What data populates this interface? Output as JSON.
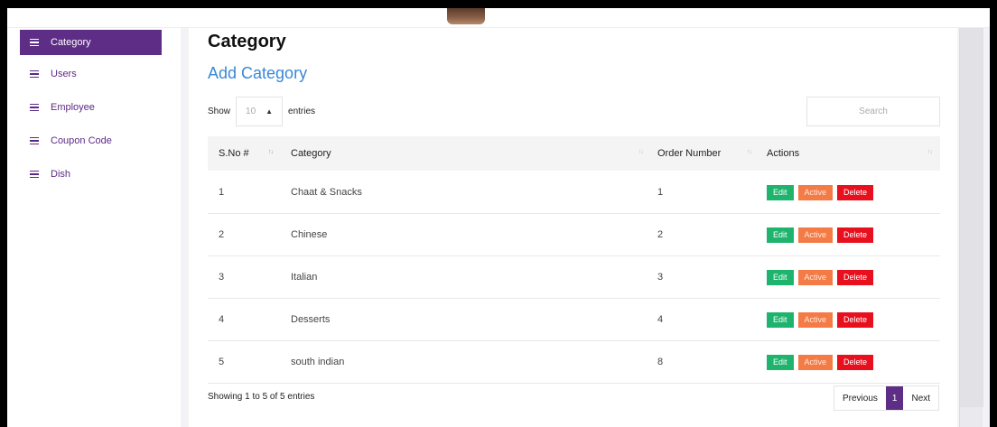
{
  "sidebar": {
    "items": [
      {
        "label": "Category",
        "active": true
      },
      {
        "label": "Users",
        "active": false
      },
      {
        "label": "Employee",
        "active": false
      },
      {
        "label": "Coupon Code",
        "active": false
      },
      {
        "label": "Dish",
        "active": false
      }
    ]
  },
  "page": {
    "title": "Category",
    "add_label": "Add Category"
  },
  "length_control": {
    "prefix": "Show",
    "value": "10",
    "suffix": "entries"
  },
  "search": {
    "placeholder": "Search"
  },
  "table": {
    "headers": [
      "S.No #",
      "Category",
      "Order Number",
      "Actions"
    ],
    "rows": [
      {
        "sno": "1",
        "category": "Chaat & Snacks",
        "order": "1"
      },
      {
        "sno": "2",
        "category": "Chinese",
        "order": "2"
      },
      {
        "sno": "3",
        "category": "Italian",
        "order": "3"
      },
      {
        "sno": "4",
        "category": "Desserts",
        "order": "4"
      },
      {
        "sno": "5",
        "category": "south indian",
        "order": "8"
      }
    ],
    "actions": {
      "edit": "Edit",
      "active": "Active",
      "delete": "Delete"
    }
  },
  "footer": {
    "info": "Showing 1 to 5 of 5 entries",
    "previous": "Previous",
    "current_page": "1",
    "next": "Next"
  },
  "colors": {
    "brand": "#5e2d86",
    "link": "#3a87d6",
    "edit": "#1fb46e",
    "active": "#f47b45",
    "delete": "#e8101e"
  },
  "icons": {
    "menu": "menu-lines-icon",
    "sort": "sort-arrows-icon"
  }
}
